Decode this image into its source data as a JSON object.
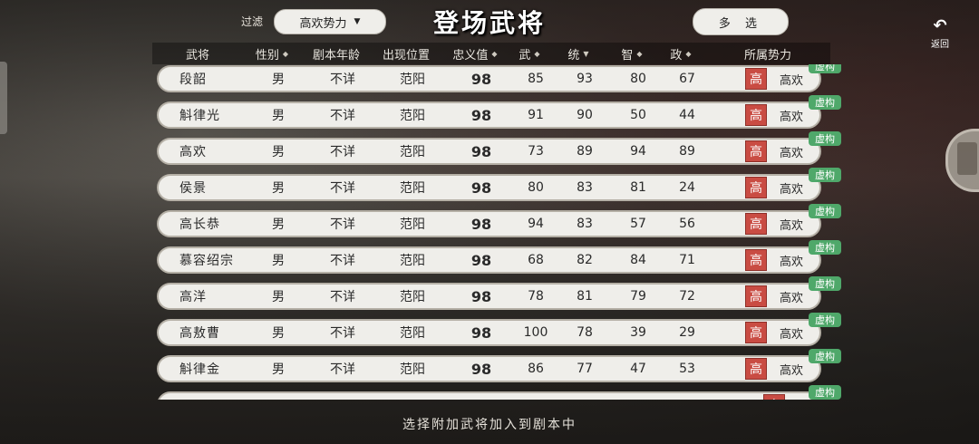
{
  "header": {
    "filter_label": "过滤",
    "filter_value": "高欢势力",
    "title": "登场武将",
    "multi_select_label": "多 选",
    "back_label": "返回"
  },
  "table": {
    "columns": [
      "武将",
      "性别",
      "剧本年龄",
      "出现位置",
      "忠义值",
      "武",
      "统",
      "智",
      "政",
      "所属势力"
    ],
    "rows": [
      {
        "name": "段韶",
        "gender": "男",
        "age": "不详",
        "location": "范阳",
        "loyalty": "98",
        "str": "85",
        "lead": "93",
        "int": "80",
        "pol": "67",
        "faction_badge": "高",
        "faction": "高欢",
        "tag": "虚构"
      },
      {
        "name": "斛律光",
        "gender": "男",
        "age": "不详",
        "location": "范阳",
        "loyalty": "98",
        "str": "91",
        "lead": "90",
        "int": "50",
        "pol": "44",
        "faction_badge": "高",
        "faction": "高欢",
        "tag": "虚构"
      },
      {
        "name": "高欢",
        "gender": "男",
        "age": "不详",
        "location": "范阳",
        "loyalty": "98",
        "str": "73",
        "lead": "89",
        "int": "94",
        "pol": "89",
        "faction_badge": "高",
        "faction": "高欢",
        "tag": "虚构"
      },
      {
        "name": "侯景",
        "gender": "男",
        "age": "不详",
        "location": "范阳",
        "loyalty": "98",
        "str": "80",
        "lead": "83",
        "int": "81",
        "pol": "24",
        "faction_badge": "高",
        "faction": "高欢",
        "tag": "虚构"
      },
      {
        "name": "高长恭",
        "gender": "男",
        "age": "不详",
        "location": "范阳",
        "loyalty": "98",
        "str": "94",
        "lead": "83",
        "int": "57",
        "pol": "56",
        "faction_badge": "高",
        "faction": "高欢",
        "tag": "虚构"
      },
      {
        "name": "慕容绍宗",
        "gender": "男",
        "age": "不详",
        "location": "范阳",
        "loyalty": "98",
        "str": "68",
        "lead": "82",
        "int": "84",
        "pol": "71",
        "faction_badge": "高",
        "faction": "高欢",
        "tag": "虚构"
      },
      {
        "name": "高洋",
        "gender": "男",
        "age": "不详",
        "location": "范阳",
        "loyalty": "98",
        "str": "78",
        "lead": "81",
        "int": "79",
        "pol": "72",
        "faction_badge": "高",
        "faction": "高欢",
        "tag": "虚构"
      },
      {
        "name": "高敖曹",
        "gender": "男",
        "age": "不详",
        "location": "范阳",
        "loyalty": "98",
        "str": "100",
        "lead": "78",
        "int": "39",
        "pol": "29",
        "faction_badge": "高",
        "faction": "高欢",
        "tag": "虚构"
      },
      {
        "name": "斛律金",
        "gender": "男",
        "age": "不详",
        "location": "范阳",
        "loyalty": "98",
        "str": "86",
        "lead": "77",
        "int": "47",
        "pol": "53",
        "faction_badge": "高",
        "faction": "高欢",
        "tag": "虚构"
      }
    ]
  },
  "partial_row": {
    "faction_badge": "高",
    "tag": "虚构"
  },
  "footer": {
    "hint": "选择附加武将加入到剧本中"
  },
  "colors": {
    "faction_badge": "#c94c43",
    "tag": "#4fa86a",
    "row_bg": "#efeeea"
  }
}
